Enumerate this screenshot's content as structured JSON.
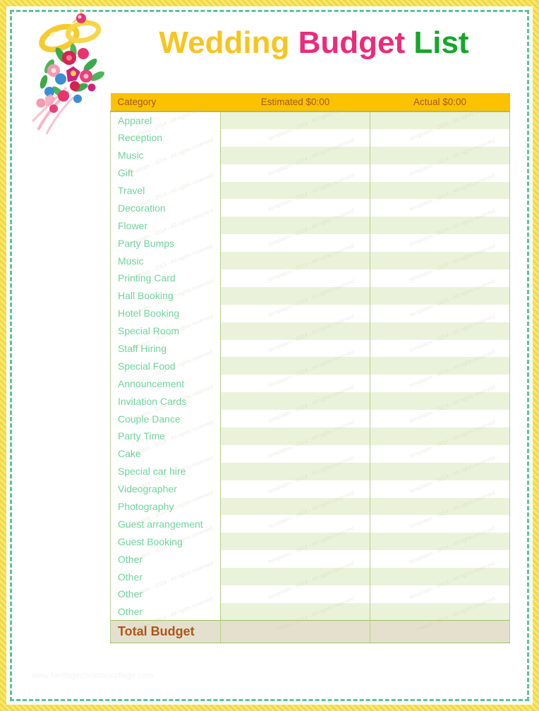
{
  "page": {
    "title_parts": {
      "wedding": "Wedding",
      "budget": "Budget",
      "list": "List"
    },
    "footer_url": "www.heritagechristiancollege.com",
    "watermark_text": "templates - 2014 - All rights reserved"
  },
  "colors": {
    "title_wedding": "#f7c51e",
    "title_budget": "#ed2a7b",
    "title_list": "#14a82a",
    "header_bg": "#fcc200",
    "header_text": "#a05a22",
    "category_text": "#6ed49c",
    "stripe_bg": "#eaf3da",
    "row_bg": "#ffffff",
    "grid_line": "#b9cf8c",
    "header_underline": "#9cc25c",
    "total_bg": "#e4e0cd",
    "total_text": "#b0541a",
    "page_border": "#f2d83d",
    "dashed_border": "#55c69a",
    "footer_text": "#f2f2f4"
  },
  "decoration": {
    "name": "wedding-rings-bouquet",
    "ring_color": "#f5cb2e",
    "ribbon_color": "#f6a8b8",
    "flower_colors": [
      "#e8336e",
      "#e8407a",
      "#d8224f",
      "#3a8fd4",
      "#f4d43a",
      "#f29bb2"
    ],
    "leaf_color": "#3da84a"
  },
  "table": {
    "headers": {
      "category": "Category",
      "estimated": "Estimated    $0:00",
      "actual": "Actual $0:00"
    },
    "rows": [
      {
        "category": "Apparel",
        "estimated": "",
        "actual": ""
      },
      {
        "category": "Reception",
        "estimated": "",
        "actual": ""
      },
      {
        "category": "Music",
        "estimated": "",
        "actual": ""
      },
      {
        "category": "Gift",
        "estimated": "",
        "actual": ""
      },
      {
        "category": "Travel",
        "estimated": "",
        "actual": ""
      },
      {
        "category": "Decoration",
        "estimated": "",
        "actual": ""
      },
      {
        "category": "Flower",
        "estimated": "",
        "actual": ""
      },
      {
        "category": "Party Bumps",
        "estimated": "",
        "actual": ""
      },
      {
        "category": "Music",
        "estimated": "",
        "actual": ""
      },
      {
        "category": "Printing Card",
        "estimated": "",
        "actual": ""
      },
      {
        "category": "Hall Booking",
        "estimated": "",
        "actual": ""
      },
      {
        "category": "Hotel Booking",
        "estimated": "",
        "actual": ""
      },
      {
        "category": "Special Room",
        "estimated": "",
        "actual": ""
      },
      {
        "category": "Staff Hiring",
        "estimated": "",
        "actual": ""
      },
      {
        "category": "Special Food",
        "estimated": "",
        "actual": ""
      },
      {
        "category": "Announcement",
        "estimated": "",
        "actual": ""
      },
      {
        "category": "Invitation Cards",
        "estimated": "",
        "actual": ""
      },
      {
        "category": "Couple Dance",
        "estimated": "",
        "actual": ""
      },
      {
        "category": "Party Time",
        "estimated": "",
        "actual": ""
      },
      {
        "category": "Cake",
        "estimated": "",
        "actual": ""
      },
      {
        "category": "Special car hire",
        "estimated": "",
        "actual": ""
      },
      {
        "category": "Videographer",
        "estimated": "",
        "actual": ""
      },
      {
        "category": "Photography",
        "estimated": "",
        "actual": ""
      },
      {
        "category": "Guest arrangement",
        "estimated": "",
        "actual": ""
      },
      {
        "category": "Guest Booking",
        "estimated": "",
        "actual": ""
      },
      {
        "category": "Other",
        "estimated": "",
        "actual": ""
      },
      {
        "category": "Other",
        "estimated": "",
        "actual": ""
      },
      {
        "category": "Other",
        "estimated": "",
        "actual": ""
      },
      {
        "category": "Other",
        "estimated": "",
        "actual": ""
      }
    ],
    "section_break_after_index": 12,
    "total": {
      "label": "Total Budget",
      "estimated": "",
      "actual": ""
    }
  }
}
